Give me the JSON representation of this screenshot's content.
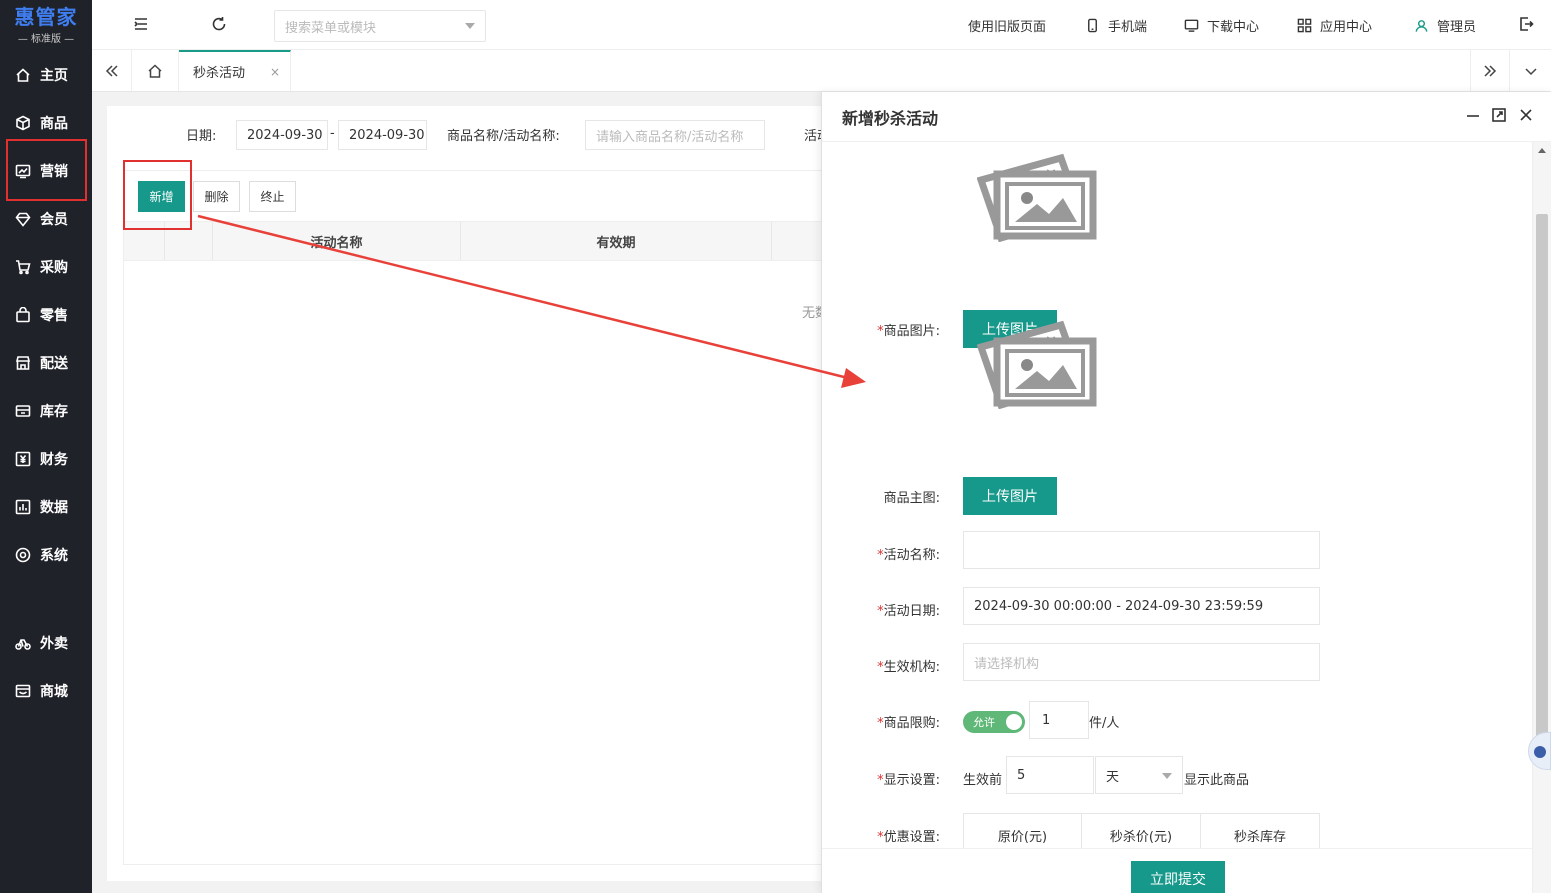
{
  "logo": {
    "title": "惠管家",
    "subtitle": "— 标准版 —"
  },
  "sidebar": {
    "items": [
      {
        "label": "主页",
        "icon": "home-icon"
      },
      {
        "label": "商品",
        "icon": "box-icon"
      },
      {
        "label": "营销",
        "icon": "chart-icon"
      },
      {
        "label": "会员",
        "icon": "diamond-icon"
      },
      {
        "label": "采购",
        "icon": "cart-icon"
      },
      {
        "label": "零售",
        "icon": "bag-icon"
      },
      {
        "label": "配送",
        "icon": "store-icon"
      },
      {
        "label": "库存",
        "icon": "inventory-icon"
      },
      {
        "label": "财务",
        "icon": "yuan-icon"
      },
      {
        "label": "数据",
        "icon": "bar-chart-icon"
      },
      {
        "label": "系统",
        "icon": "settings-icon"
      },
      {
        "label": "外卖",
        "icon": "bike-icon"
      },
      {
        "label": "商城",
        "icon": "shop-icon"
      }
    ]
  },
  "topbar": {
    "search_placeholder": "搜索菜单或模块",
    "old_page": "使用旧版页面",
    "mobile": "手机端",
    "download": "下载中心",
    "apps": "应用中心",
    "user": "管理员"
  },
  "tabs": {
    "active": "秒杀活动",
    "close": "×"
  },
  "filter": {
    "date_label": "日期:",
    "date_start": "2024-09-30",
    "date_sep": "-",
    "date_end": "2024-09-30",
    "name_label": "商品名称/活动名称:",
    "name_placeholder": "请输入商品名称/活动名称",
    "extra_label": "活动"
  },
  "toolbar": {
    "add": "新增",
    "delete": "删除",
    "stop": "终止"
  },
  "table": {
    "headers": [
      "活动名称",
      "有效期"
    ],
    "empty": "无数"
  },
  "modal": {
    "title": "新增秒杀活动",
    "product_image_label": "商品图片:",
    "main_image_label": "商品主图:",
    "upload": "上传图片",
    "activity_name_label": "活动名称:",
    "activity_date_label": "活动日期:",
    "activity_date_value": "2024-09-30 00:00:00 - 2024-09-30 23:59:59",
    "org_label": "生效机构:",
    "org_placeholder": "请选择机构",
    "limit_label": "商品限购:",
    "limit_toggle": "允许",
    "limit_value": "1",
    "limit_unit": "件/人",
    "display_label": "显示设置:",
    "display_prefix": "生效前",
    "display_value": "5",
    "display_unit": "天",
    "display_suffix": "显示此商品",
    "discount_label": "优惠设置:",
    "price_headers": [
      "原价(元)",
      "秒杀价(元)",
      "秒杀库存"
    ],
    "submit": "立即提交"
  },
  "colors": {
    "primary": "#16988a",
    "sidebar": "#20222a",
    "highlight": "#e0302f"
  }
}
